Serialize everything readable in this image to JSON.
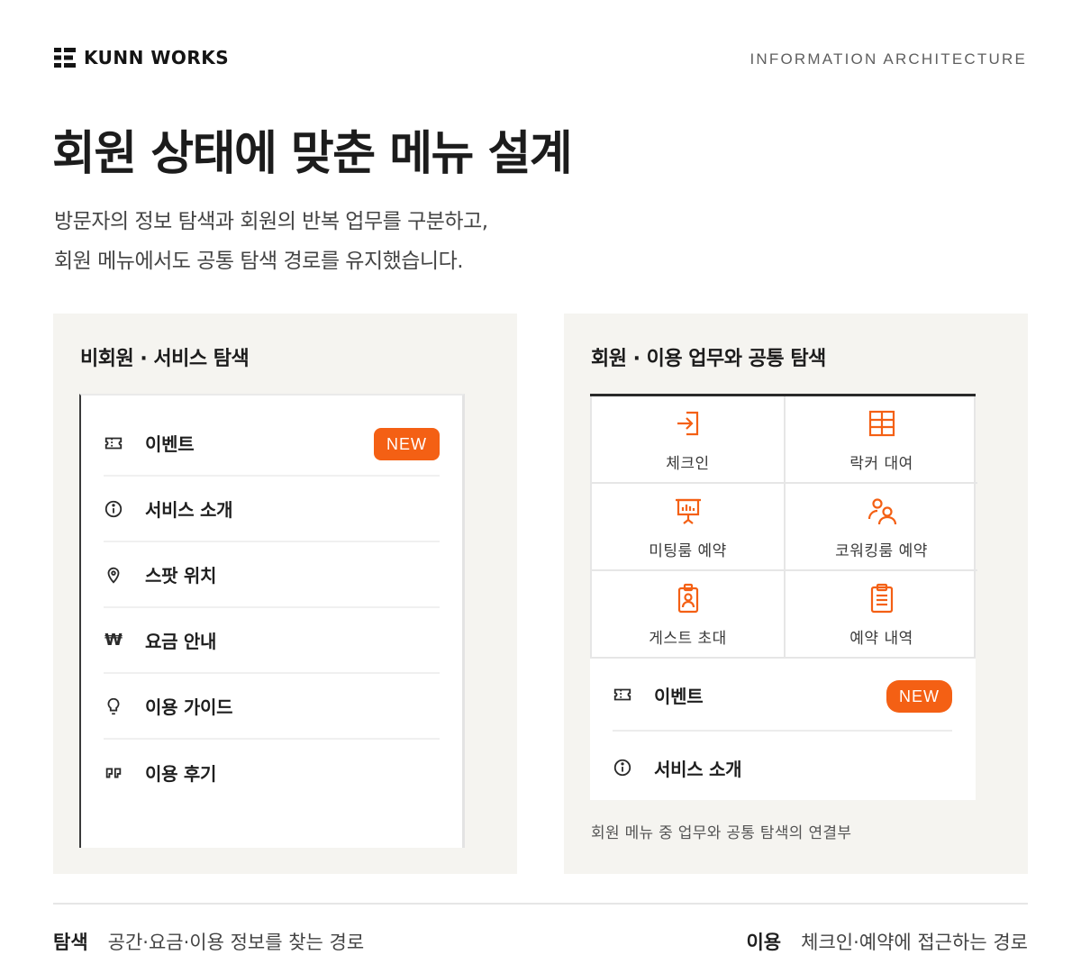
{
  "header": {
    "brand_name": "KUNN WORKS",
    "section_label": "INFORMATION ARCHITECTURE",
    "title": "회원 상태에 맞춘 메뉴 설계",
    "description_line1": "방문자의 정보 탐색과 회원의 반복 업무를 구분하고,",
    "description_line2": "회원 메뉴에서도 공통 탐색 경로를 유지했습니다."
  },
  "left_panel": {
    "title": "비회원 · 서비스 탐색",
    "items": [
      {
        "label": "이벤트",
        "icon": "ticket-icon",
        "badge": "NEW"
      },
      {
        "label": "서비스 소개",
        "icon": "info-icon"
      },
      {
        "label": "스팟 위치",
        "icon": "location-pin-icon"
      },
      {
        "label": "요금 안내",
        "icon": "won-icon"
      },
      {
        "label": "이용 가이드",
        "icon": "lightbulb-icon"
      },
      {
        "label": "이용 후기",
        "icon": "quote-icon"
      }
    ]
  },
  "right_panel": {
    "title": "회원 · 이용 업무와 공통 탐색",
    "tiles": [
      {
        "label": "체크인",
        "icon": "check-in-icon"
      },
      {
        "label": "락커 대여",
        "icon": "locker-icon"
      },
      {
        "label": "미팅룸 예약",
        "icon": "presentation-icon"
      },
      {
        "label": "코워킹룸 예약",
        "icon": "people-icon"
      },
      {
        "label": "게스트 초대",
        "icon": "badge-icon"
      },
      {
        "label": "예약 내역",
        "icon": "clipboard-icon"
      }
    ],
    "items": [
      {
        "label": "이벤트",
        "icon": "ticket-icon",
        "badge": "NEW"
      },
      {
        "label": "서비스 소개",
        "icon": "info-icon"
      }
    ],
    "caption": "회원 메뉴 중 업무와 공통 탐색의 연결부"
  },
  "footer": {
    "left_key": "탐색",
    "left_text": "공간·요금·이용 정보를 찾는 경로",
    "right_key": "이용",
    "right_text": "체크인·예약에 접근하는 경로"
  },
  "colors": {
    "accent": "#f46014",
    "panel_bg": "#f5f4f0",
    "text_dark": "#1f1f1f"
  }
}
